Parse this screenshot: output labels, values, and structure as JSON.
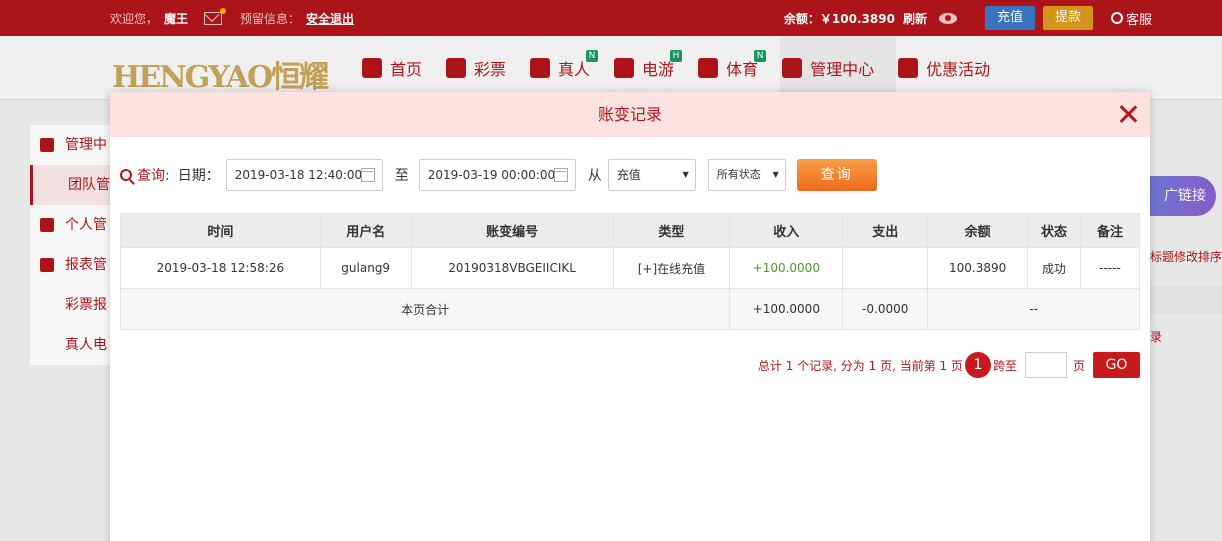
{
  "topbar": {
    "welcome": "欢迎您，",
    "username": "魔王",
    "reserve_label": "预留信息：",
    "logout": "安全退出",
    "balance": "余额：￥100.3890",
    "refresh": "刷新",
    "recharge": "充值",
    "withdraw": "提款",
    "service": "客服"
  },
  "logo": "HENGYAO恒耀",
  "nav": [
    {
      "label": "首页",
      "icon": "home-icon"
    },
    {
      "label": "彩票",
      "icon": "lottery-ticket-icon"
    },
    {
      "label": "真人",
      "icon": "dealer-icon",
      "badge": "N"
    },
    {
      "label": "电游",
      "icon": "slot-icon",
      "badge": "H"
    },
    {
      "label": "体育",
      "icon": "trophy-icon",
      "badge": "N"
    },
    {
      "label": "管理中心",
      "icon": "users-icon"
    },
    {
      "label": "优惠活动",
      "icon": "gift-icon"
    }
  ],
  "sidebar": [
    "管理中",
    "团队管",
    "个人管",
    "报表管",
    "彩票报",
    "真人电"
  ],
  "right_bg": {
    "button": "广链接",
    "text1": "标题修改排序",
    "text2": "录"
  },
  "modal": {
    "title": "账变记录",
    "query_label": "查询:",
    "date_label": "日期：",
    "date_from": "2019-03-18 12:40:00",
    "to_label": "至",
    "date_to": "2019-03-19 00:00:00",
    "from_label": "从",
    "type_select": "充值",
    "status_select": "所有状态",
    "search_button": "查询",
    "table": {
      "headers": [
        "时间",
        "用户名",
        "账变编号",
        "类型",
        "收入",
        "支出",
        "余额",
        "状态",
        "备注"
      ],
      "rows": [
        [
          "2019-03-18 12:58:26",
          "gulang9",
          "20190318VBGEIICIKL",
          "[+]在线充值",
          "+100.0000",
          "",
          "100.3890",
          "成功",
          "-----"
        ]
      ],
      "summary": {
        "label": "本页合计",
        "income": "+100.0000",
        "expense": "-0.0000",
        "rest": "--"
      }
    },
    "pager": {
      "summary": "总计 1 个记录, 分为 1 页, 当前第 1 页",
      "current": "1",
      "goto_label": "跨至",
      "page_label": "页",
      "go_button": "GO"
    }
  }
}
